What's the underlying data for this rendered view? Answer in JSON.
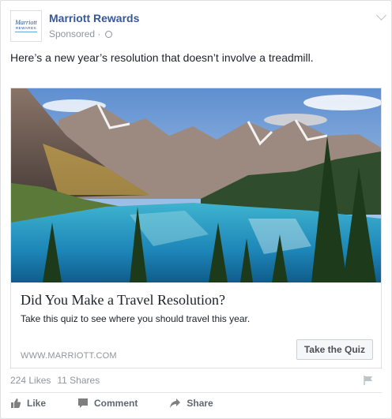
{
  "post": {
    "page_name": "Marriott Rewards",
    "sponsored": "Sponsored · ",
    "text": "Here’s a new year’s resolution that doesn’t involve a treadmill.",
    "logo": {
      "top": "Marriott",
      "bottom": "REWARDS"
    }
  },
  "ad": {
    "headline": "Did You Make a Travel Resolution?",
    "description": "Take this quiz to see where you should travel this year.",
    "domain": "WWW.MARRIOTT.COM",
    "cta": "Take the Quiz",
    "image_icon": "mountain-lake-photo"
  },
  "stats": {
    "likes": "224 Likes",
    "shares": "11 Shares"
  },
  "actions": {
    "like": "Like",
    "comment": "Comment",
    "share": "Share"
  },
  "icons": [
    "globe-icon",
    "chevron-down-icon",
    "flag-icon",
    "like-icon",
    "comment-icon",
    "share-icon"
  ],
  "colors": {
    "link": "#365899",
    "meta": "#90949c",
    "text": "#1d2129"
  }
}
